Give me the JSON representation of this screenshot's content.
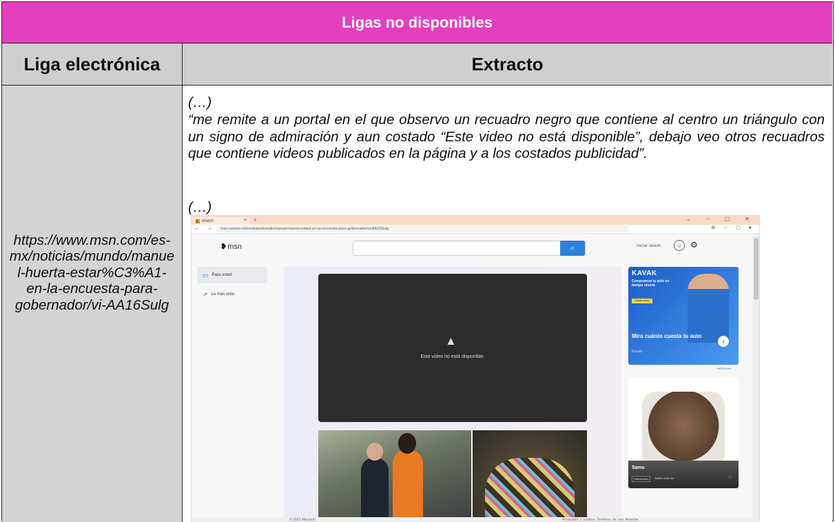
{
  "table": {
    "title": "Ligas no disponibles",
    "col_link": "Liga electrónica",
    "col_excerpt": "Extracto",
    "link": "https://www.msn.com/es-mx/noticias/mundo/manuel-huerta-estar%C3%A1-en-la-encuesta-para-gobernador/vi-AA16Sulg",
    "ellipsis_top": "(…)",
    "quote": "“me remite a un portal en el que observo un recuadro negro que contiene al centro un triángulo con un signo de admiración y aun costado “Este video no está disponible”, debajo veo otros recuadros que contiene videos publicados en la página y a los costados publicidad”.",
    "ellipsis_bottom": "(…)"
  },
  "screenshot": {
    "tab_title": "Watch",
    "window_controls": "⌄ – ▢ ✕",
    "url": "msn.com/es-mx/noticias/mundo/manuel-huerta-estará-en-la-encuesta-para-gobernador/vi-AA16Sulg",
    "logo": "msn",
    "sign_in": "Iniciar sesión",
    "sidebar": [
      {
        "label": "Para usted",
        "icon": "monitor-icon"
      },
      {
        "label": "Lo más visto",
        "icon": "trending-icon"
      }
    ],
    "player_message": "Este video no está disponible.",
    "ad1": {
      "brand_logo": "KAVAK",
      "subtitle": "Compramos tu auto en tiempo récord.",
      "button": "Vender ahora",
      "title": "Mira cuánto cuesta tu auto",
      "advertiser": "Kavak"
    },
    "adchoices": "AdChoices",
    "ad2": {
      "name": "Sams",
      "tag": "Patrocinado",
      "site": "Sams.com.mx"
    },
    "footer": {
      "copyright": "© 2023 Microsoft",
      "links": "Privacidad y cookies   Términos de uso   Anunciar"
    }
  }
}
